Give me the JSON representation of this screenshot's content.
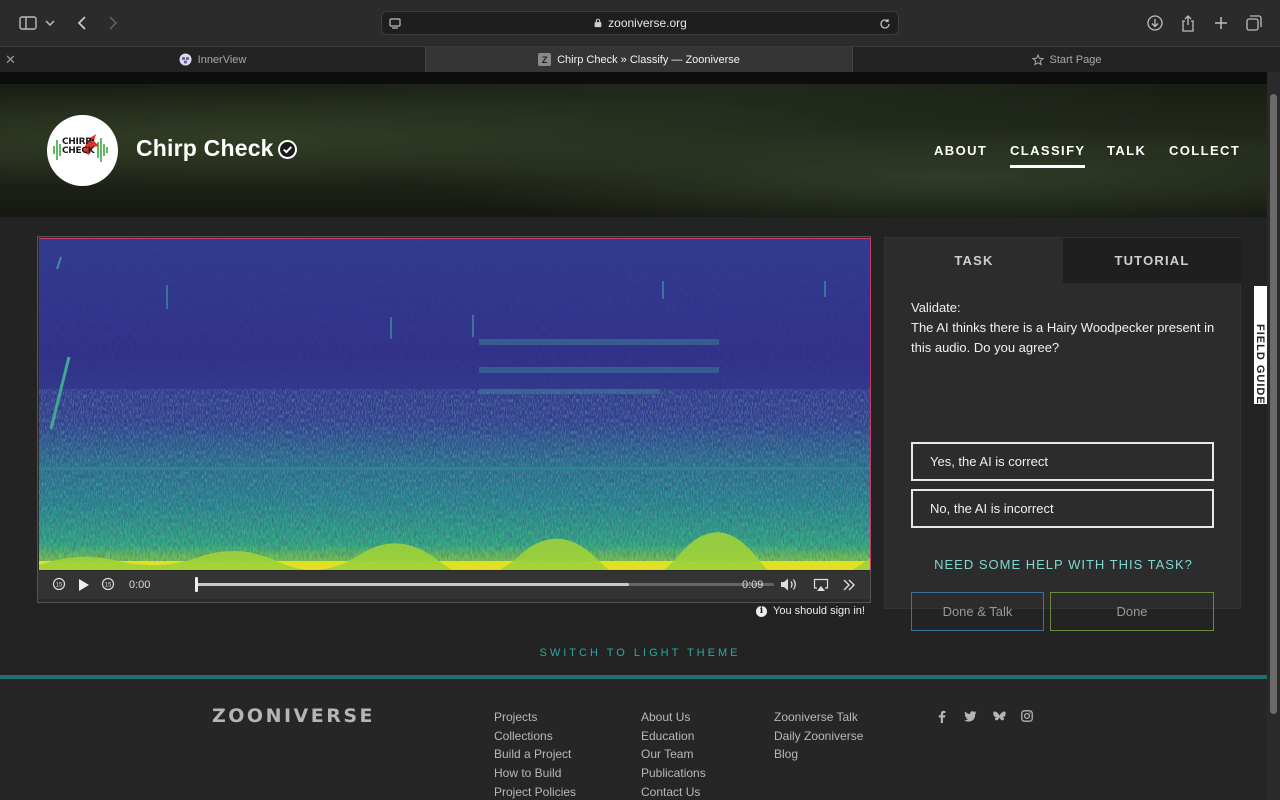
{
  "browser": {
    "url": "zooniverse.org",
    "tabs": [
      {
        "label": "InnerView"
      },
      {
        "label": "Chirp Check » Classify — Zooniverse"
      },
      {
        "label": "Start Page"
      }
    ]
  },
  "header": {
    "project_title": "Chirp Check",
    "logo_text": "CHIRP\nCHECK",
    "nav": [
      "ABOUT",
      "CLASSIFY",
      "TALK",
      "COLLECT"
    ],
    "active_nav": "CLASSIFY"
  },
  "player": {
    "current_time": "0:00",
    "duration": "0:09",
    "buffered_fraction": 0.75,
    "skip_seconds": "15"
  },
  "signin_notice": "You should sign in!",
  "task_panel": {
    "tabs": [
      "TASK",
      "TUTORIAL"
    ],
    "question_line1": "Validate:",
    "question_line2": "The AI thinks there is a Hairy Woodpecker present in this audio. Do you agree?",
    "answers": [
      "Yes, the AI is correct",
      "No, the AI is incorrect"
    ],
    "help_link": "NEED SOME HELP WITH THIS TASK?",
    "done_talk": "Done & Talk",
    "done": "Done",
    "field_guide": "FIELD GUIDE"
  },
  "switch_theme": "SWITCH TO LIGHT THEME",
  "footer": {
    "logo": "ZOONIVERSE",
    "col1": [
      "Projects",
      "Collections",
      "Build a Project",
      "How to Build",
      "Project Policies"
    ],
    "col2": [
      "About Us",
      "Education",
      "Our Team",
      "Publications",
      "Contact Us"
    ],
    "col3": [
      "Zooniverse Talk",
      "Daily Zooniverse",
      "Blog"
    ],
    "social": [
      "facebook-icon",
      "twitter-icon",
      "bluesky-icon",
      "instagram-icon"
    ]
  },
  "colors": {
    "accent_teal": "#2aa9a2",
    "help_teal": "#7fd6d2",
    "done_border": "#6a8a3a",
    "done_talk_border": "#3b7399"
  }
}
